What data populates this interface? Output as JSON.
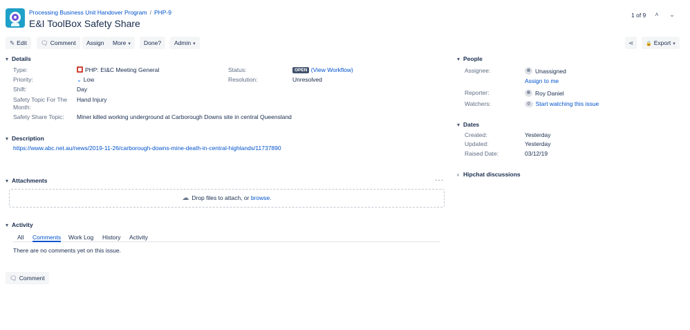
{
  "header": {
    "project_name": "Processing Business Unit Handover Program",
    "separator": "/",
    "issue_key": "PHP-9",
    "title": "E&I ToolBox Safety Share",
    "pager_text": "1 of 9",
    "prev_glyph": "˄",
    "next_glyph": "⌄"
  },
  "toolbar": {
    "edit_label": "Edit",
    "comment_label": "Comment",
    "assign_label": "Assign",
    "more_label": "More",
    "done_label": "Done?",
    "admin_label": "Admin",
    "export_label": "Export",
    "caret_glyph": "▾"
  },
  "icons": {
    "pencil": "✎",
    "speech": "🗨",
    "share": "⋖",
    "lock": "🔒",
    "twisty": "▾",
    "twisty_closed": "›",
    "cloud": "☁",
    "priority_low": "⌄",
    "ellipsis": "···"
  },
  "details": {
    "heading": "Details",
    "type_label": "Type:",
    "type_value": "PHP: EI&C Meeting General",
    "priority_label": "Priority:",
    "priority_value": "Low",
    "shift_label": "Shift:",
    "shift_value": "Day",
    "safety_topic_label_1": "Safety Topic For The",
    "safety_topic_label_2": "Month:",
    "safety_topic_value": "Hand Injury",
    "safety_share_label": "Safety Share Topic:",
    "safety_share_value": "Miner killed working underground at Carborough Downs site in central Queensland",
    "status_label": "Status:",
    "status_value": "OPEN",
    "workflow_link": "(View Workflow)",
    "resolution_label": "Resolution:",
    "resolution_value": "Unresolved"
  },
  "description": {
    "heading": "Description",
    "link": "https://www.abc.net.au/news/2019-11-26/carborough-downs-mine-death-in-central-highlands/11737890"
  },
  "attachments": {
    "heading": "Attachments",
    "drop_text": "Drop files to attach, or",
    "browse_link": "browse."
  },
  "activity": {
    "heading": "Activity",
    "tabs": [
      "All",
      "Comments",
      "Work Log",
      "History",
      "Activity"
    ],
    "active_tab": "Comments",
    "empty_text": "There are no comments yet on this issue.",
    "comment_button": "Comment"
  },
  "people": {
    "heading": "People",
    "assignee_label": "Assignee:",
    "assignee_value": "Unassigned",
    "assign_to_me": "Assign to me",
    "reporter_label": "Reporter:",
    "reporter_value": "Roy Daniel",
    "watchers_label": "Watchers:",
    "watchers_count": "0",
    "watch_link": "Start watching this issue"
  },
  "dates": {
    "heading": "Dates",
    "created_label": "Created:",
    "created_value": "Yesterday",
    "updated_label": "Updated:",
    "updated_value": "Yesterday",
    "raised_label": "Raised Date:",
    "raised_value": "03/12/19"
  },
  "hipchat": {
    "heading": "Hipchat discussions"
  },
  "colors": {
    "link": "#0052cc",
    "text": "#172b4d",
    "label": "#5e6c84",
    "button_bg": "#f4f5f7",
    "status_lozenge": "#42526e",
    "project_avatar": "#1fa0c8"
  }
}
